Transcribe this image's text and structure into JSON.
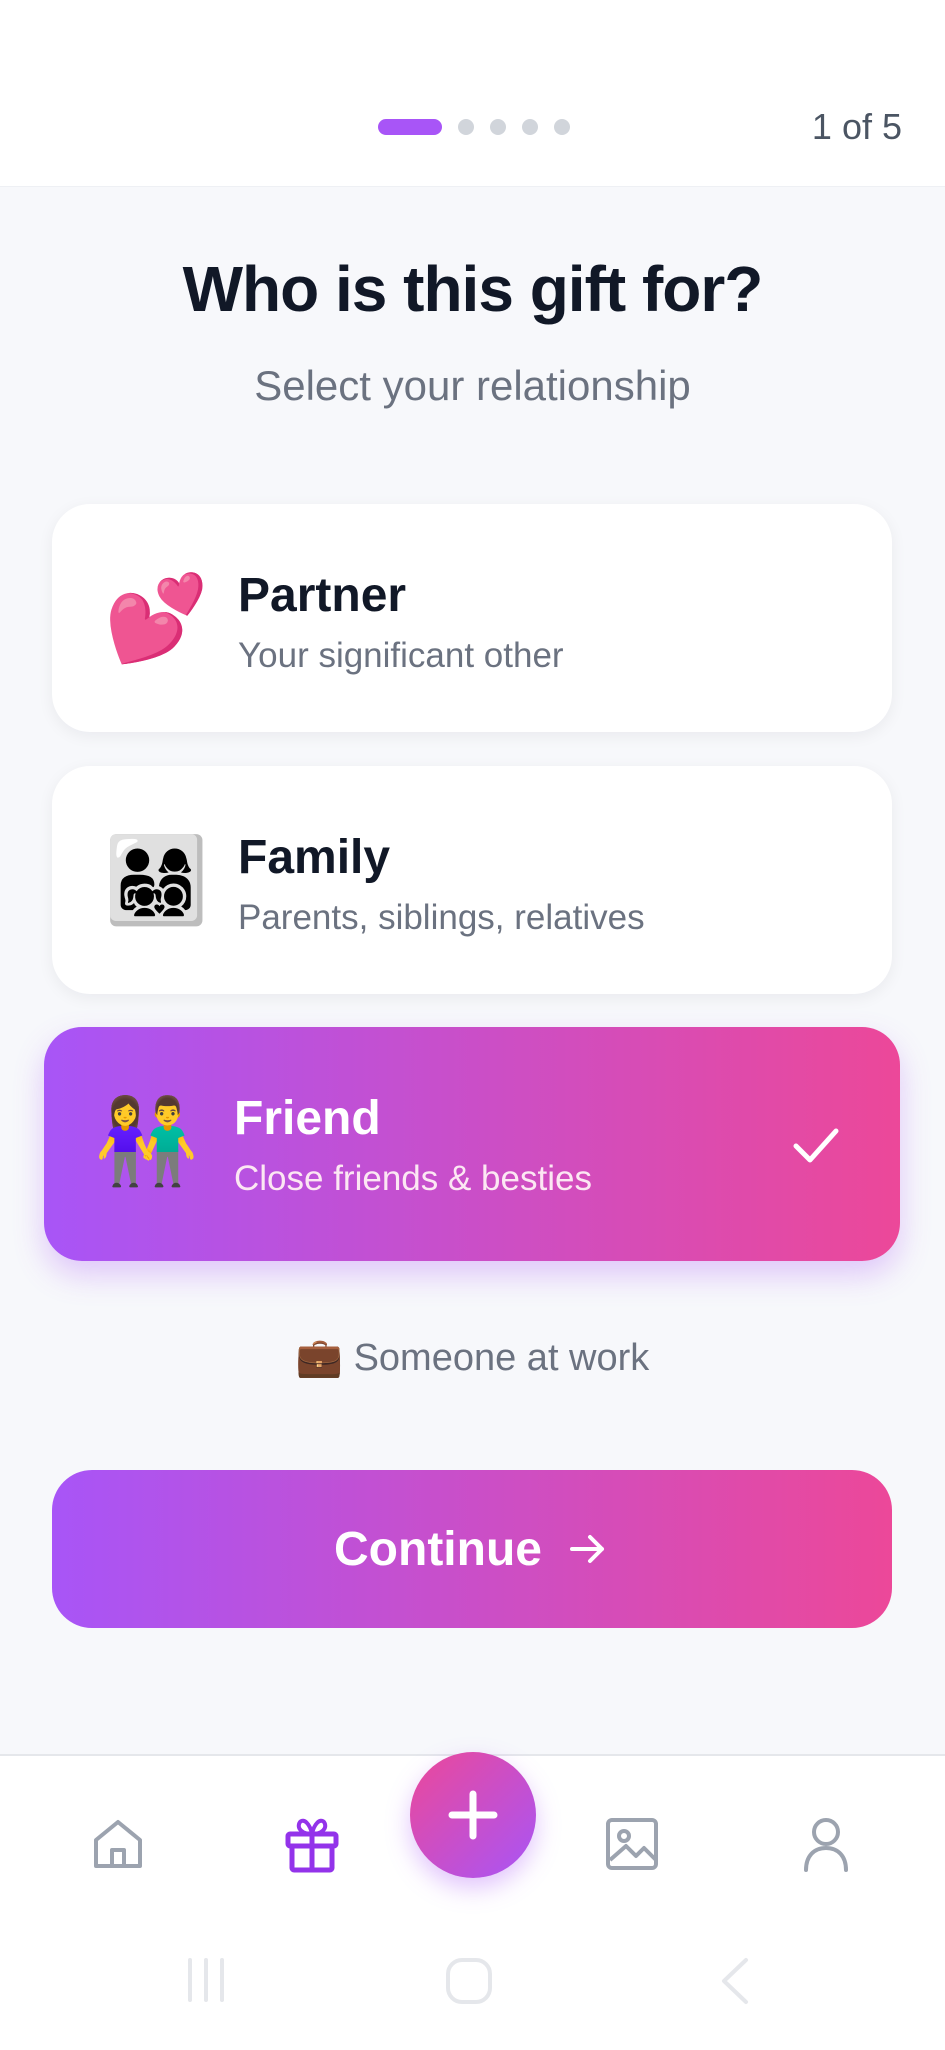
{
  "progress": {
    "total_steps": 5,
    "current_step": 1,
    "label": "1 of 5"
  },
  "header": {
    "title": "Who is this gift for?",
    "subtitle": "Select your relationship"
  },
  "options": [
    {
      "emoji": "💕",
      "label": "Partner",
      "description": "Your significant other",
      "selected": false
    },
    {
      "emoji": "👨‍👩‍👧‍👦",
      "label": "Family",
      "description": "Parents, siblings, relatives",
      "selected": false
    },
    {
      "emoji": "👫",
      "label": "Friend",
      "description": "Close friends & besties",
      "selected": true
    }
  ],
  "work_option": {
    "emoji": "💼",
    "label": "Someone at work"
  },
  "continue_button": {
    "label": "Continue"
  },
  "bottom_nav": {
    "items": [
      {
        "icon": "home-icon",
        "active": false
      },
      {
        "icon": "gift-icon",
        "active": true
      },
      {
        "icon": "plus-icon",
        "active": false
      },
      {
        "icon": "image-icon",
        "active": false
      },
      {
        "icon": "user-icon",
        "active": false
      }
    ]
  },
  "colors": {
    "accent_start": "#A855F7",
    "accent_end": "#EC4899",
    "background": "#F7F8FB",
    "nav_inactive": "#9CA3AF"
  }
}
